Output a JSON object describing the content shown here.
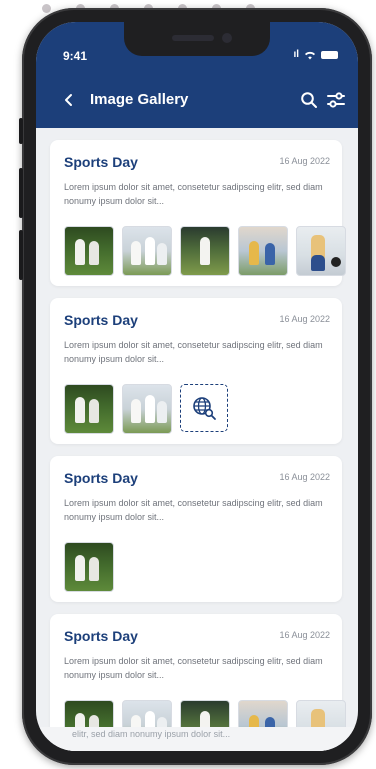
{
  "status_bar": {
    "time": "9:41",
    "signal_text": "ıl"
  },
  "nav": {
    "title": "Image Gallery",
    "back_icon": "chevron-left-icon",
    "search_icon": "search-icon",
    "filter_icon": "sliders-icon"
  },
  "colors": {
    "header": "#1c3f7a",
    "title": "#1c3f7a",
    "background": "#eef0f3"
  },
  "cards": [
    {
      "title": "Sports Day",
      "date": "16 Aug 2022",
      "description": "Lorem ipsum dolor sit amet, consetetur sadipscing elitr, sed diam nonumy ipsum dolor sit...",
      "thumbnail_count": 5
    },
    {
      "title": "Sports Day",
      "date": "16 Aug 2022",
      "description": "Lorem ipsum dolor sit amet, consetetur sadipscing elitr, sed diam nonumy ipsum dolor sit...",
      "thumbnail_count": 2,
      "extra_icon": "globe-search-icon"
    },
    {
      "title": "Sports Day",
      "date": "16 Aug 2022",
      "description": "Lorem ipsum dolor sit amet, consetetur sadipscing elitr, sed diam nonumy ipsum dolor sit...",
      "thumbnail_count": 1
    },
    {
      "title": "Sports Day",
      "date": "16 Aug 2022",
      "description": "Lorem ipsum dolor sit amet, consetetur sadipscing elitr, sed diam nonumy ipsum dolor sit...",
      "thumbnail_count": 5
    }
  ],
  "footer_peek": "elitr, sed diam nonumy ipsum dolor sit..."
}
